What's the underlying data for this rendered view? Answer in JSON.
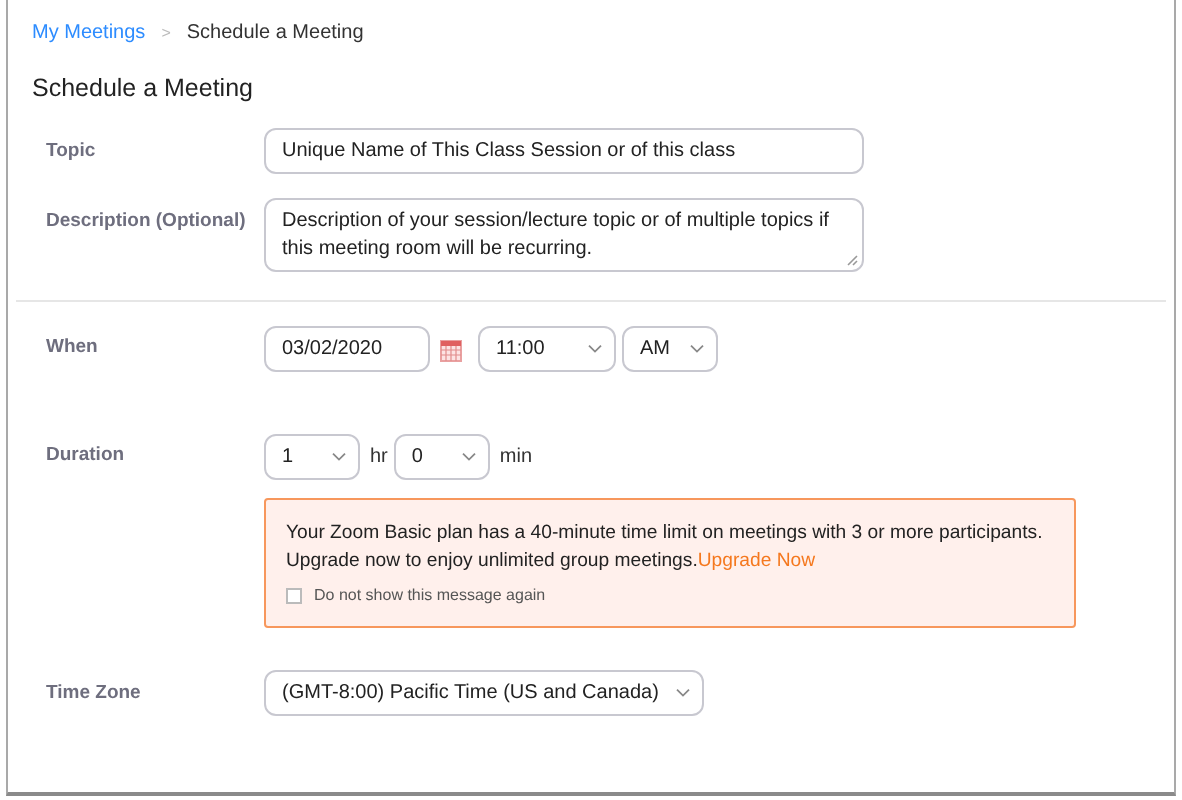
{
  "breadcrumb": {
    "link": "My Meetings",
    "separator": ">",
    "current": "Schedule a Meeting"
  },
  "title": "Schedule a Meeting",
  "topic": {
    "label": "Topic",
    "value": "Unique Name of This Class Session or of this class"
  },
  "description": {
    "label": "Description (Optional)",
    "value": "Description of your session/lecture topic or of multiple topics if this meeting room will be recurring."
  },
  "when": {
    "label": "When",
    "date": "03/02/2020",
    "time": "11:00",
    "ampm": "AM"
  },
  "duration": {
    "label": "Duration",
    "hours": "1",
    "hours_unit": "hr",
    "minutes": "0",
    "minutes_unit": "min"
  },
  "alert": {
    "message": "Your Zoom Basic plan has a 40-minute time limit on meetings with 3 or more participants. Upgrade now to enjoy unlimited group meetings.",
    "link": "Upgrade Now",
    "checkbox": {
      "label": "Do not show this message again",
      "checked": false
    }
  },
  "time_zone": {
    "label": "Time Zone",
    "value": "(GMT-8:00) Pacific Time (US and Canada)"
  }
}
